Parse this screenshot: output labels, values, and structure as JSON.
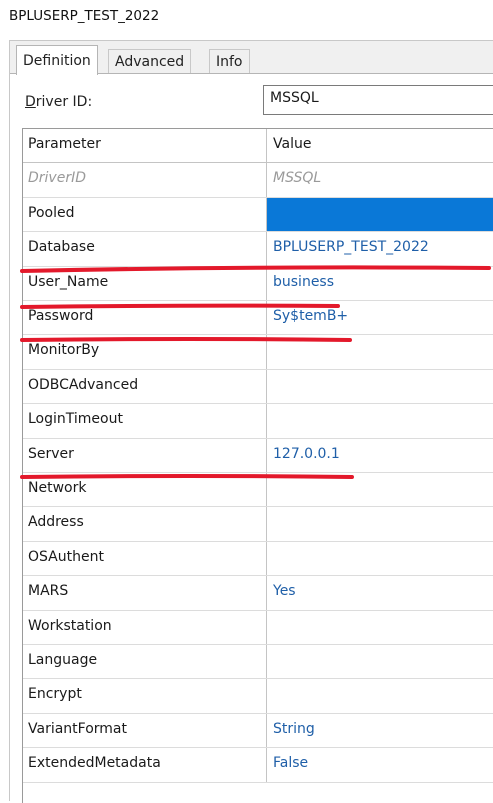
{
  "window": {
    "title": "BPLUSERP_TEST_2022"
  },
  "tabs": [
    {
      "label": "Definition",
      "active": true
    },
    {
      "label": "Advanced",
      "active": false
    },
    {
      "label": "Info",
      "active": false
    }
  ],
  "driver": {
    "label_prefix": "D",
    "label_rest": "river ID:",
    "value": "MSSQL"
  },
  "grid": {
    "columns": [
      "Parameter",
      "Value"
    ],
    "rows": [
      {
        "param": "DriverID",
        "value": "MSSQL",
        "muted": true
      },
      {
        "param": "Pooled",
        "value": "",
        "selected": true
      },
      {
        "param": "Database",
        "value": "BPLUSERP_TEST_2022"
      },
      {
        "param": "User_Name",
        "value": "business"
      },
      {
        "param": "Password",
        "value": "Sy$temB+"
      },
      {
        "param": "MonitorBy",
        "value": ""
      },
      {
        "param": "ODBCAdvanced",
        "value": ""
      },
      {
        "param": "LoginTimeout",
        "value": ""
      },
      {
        "param": "Server",
        "value": "127.0.0.1"
      },
      {
        "param": "Network",
        "value": ""
      },
      {
        "param": "Address",
        "value": ""
      },
      {
        "param": "OSAuthent",
        "value": ""
      },
      {
        "param": "MARS",
        "value": "Yes"
      },
      {
        "param": "Workstation",
        "value": ""
      },
      {
        "param": "Language",
        "value": ""
      },
      {
        "param": "Encrypt",
        "value": ""
      },
      {
        "param": "VariantFormat",
        "value": "String"
      },
      {
        "param": "ExtendedMetadata",
        "value": "False"
      }
    ]
  },
  "colors": {
    "selection": "#0a78d7",
    "value_text": "#1f5fa8",
    "annotation": "#e3192b"
  }
}
